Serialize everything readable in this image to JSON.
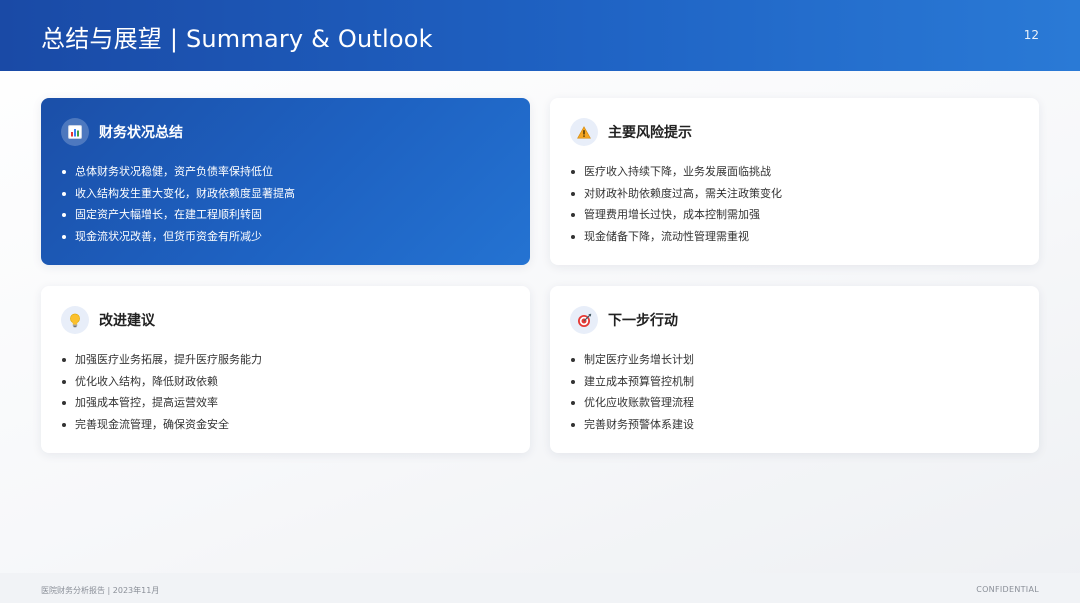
{
  "header": {
    "title": "总结与展望 | Summary & Outlook",
    "page_number": "12"
  },
  "cards": [
    {
      "title": "财务状况总结",
      "icon": "bar-chart-icon",
      "items": [
        "总体财务状况稳健，资产负债率保持低位",
        "收入结构发生重大变化，财政依赖度显著提高",
        "固定资产大幅增长，在建工程顺利转固",
        "现金流状况改善，但货币资金有所减少"
      ]
    },
    {
      "title": "主要风险提示",
      "icon": "warning-icon",
      "items": [
        "医疗收入持续下降，业务发展面临挑战",
        "对财政补助依赖度过高，需关注政策变化",
        "管理费用增长过快，成本控制需加强",
        "现金储备下降，流动性管理需重视"
      ]
    },
    {
      "title": "改进建议",
      "icon": "lightbulb-icon",
      "items": [
        "加强医疗业务拓展，提升医疗服务能力",
        "优化收入结构，降低财政依赖",
        "加强成本管控，提高运营效率",
        "完善现金流管理，确保资金安全"
      ]
    },
    {
      "title": "下一步行动",
      "icon": "target-icon",
      "items": [
        "制定医疗业务增长计划",
        "建立成本预算管控机制",
        "优化应收账款管理流程",
        "完善财务预警体系建设"
      ]
    }
  ],
  "footer": {
    "left": "医院财务分析报告 | 2023年11月",
    "right": "CONFIDENTIAL"
  },
  "colors": {
    "header_gradient_start": "#1a4aa6",
    "header_gradient_end": "#2a7ad6",
    "primary_card": "#1e62c2",
    "warning": "#f5a623",
    "target_red": "#e53935"
  }
}
